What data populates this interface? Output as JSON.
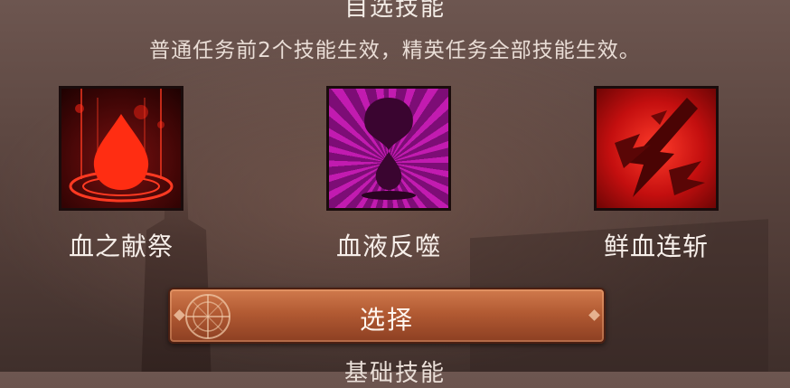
{
  "header": {
    "title": "自选技能",
    "description": "普通任务前2个技能生效，精英任务全部技能生效。"
  },
  "skills": [
    {
      "name": "血之献祭",
      "icon": "blood-drop-altar-icon"
    },
    {
      "name": "血液反噬",
      "icon": "blood-hourglass-icon"
    },
    {
      "name": "鲜血连斩",
      "icon": "blood-blade-slash-icon"
    }
  ],
  "select_button": {
    "label": "选择",
    "emblem_icon": "compass-emblem-icon"
  },
  "next_section": {
    "title": "基础技能"
  },
  "colors": {
    "button": "#b25a33",
    "icon1": "#ff2d12",
    "icon2": "#c21bb0",
    "icon3": "#ff2a1e"
  }
}
